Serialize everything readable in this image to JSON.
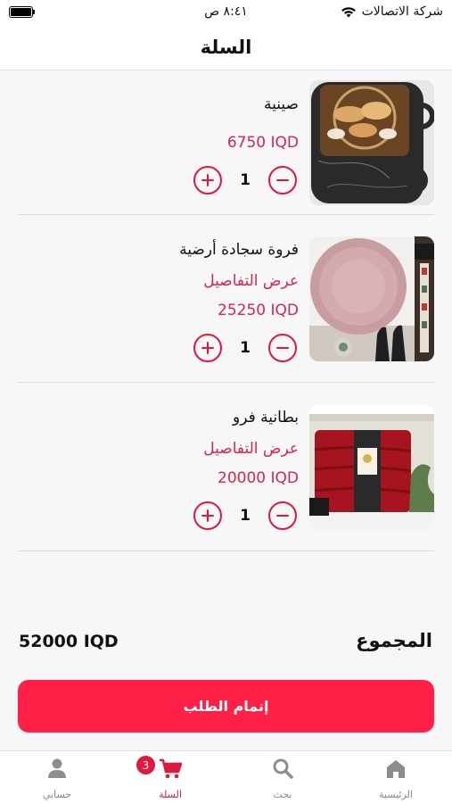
{
  "status_bar": {
    "carrier": "شركة الاتصالات",
    "time": "٨:٤١ ص",
    "battery_level": 1.0
  },
  "header": {
    "title": "السلة"
  },
  "cart": {
    "items": [
      {
        "name": "صينية",
        "details_label": "",
        "price": "6750 IQD",
        "quantity": "1"
      },
      {
        "name": "فروة سجادة أرضية",
        "details_label": "عرض التفاصيل",
        "price": "25250 IQD",
        "quantity": "1"
      },
      {
        "name": "بطانية  فرو",
        "details_label": "عرض التفاصيل",
        "price": "20000 IQD",
        "quantity": "1"
      }
    ]
  },
  "summary": {
    "total_label": "المجموع",
    "total_value": "52000 IQD"
  },
  "checkout": {
    "label": "إتمام الطلب"
  },
  "nav": {
    "items": [
      {
        "label": "الرئيسية",
        "icon": "home-icon"
      },
      {
        "label": "بحث",
        "icon": "search-icon"
      },
      {
        "label": "السلة",
        "icon": "cart-icon",
        "badge": "3"
      },
      {
        "label": "حسابي",
        "icon": "user-icon"
      }
    ]
  },
  "colors": {
    "accent": "#e0183f",
    "checkout": "#ff1f47",
    "price": "#d5264f",
    "nav_inactive": "#888888"
  }
}
